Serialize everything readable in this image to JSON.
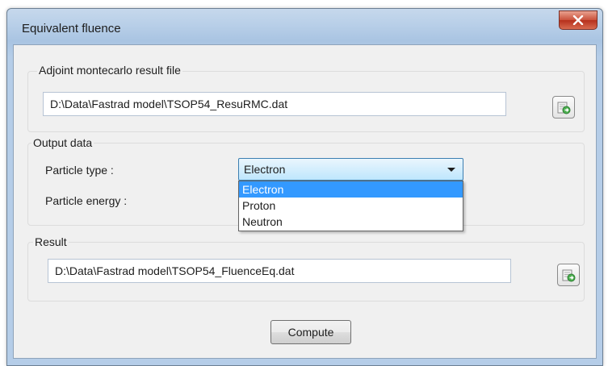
{
  "window": {
    "title": "Equivalent fluence"
  },
  "adjoint": {
    "group_label": "Adjoint montecarlo result file",
    "file_path": "D:\\Data\\Fastrad model\\TSOP54_ResuRMC.dat"
  },
  "output": {
    "group_label": "Output data",
    "particle_type_label": "Particle type :",
    "particle_energy_label": "Particle energy :",
    "particle_type_selected": "Electron",
    "particle_options": [
      "Electron",
      "Proton",
      "Neutron"
    ]
  },
  "result": {
    "group_label": "Result",
    "file_path": "D:\\Data\\Fastrad model\\TSOP54_FluenceEq.dat"
  },
  "buttons": {
    "compute_label": "Compute"
  },
  "icons": {
    "close": "close-icon",
    "browse": "folder-open-icon"
  },
  "colors": {
    "selection": "#3399ff",
    "close_button": "#c9503a",
    "combo_border": "#3c7fb1"
  }
}
